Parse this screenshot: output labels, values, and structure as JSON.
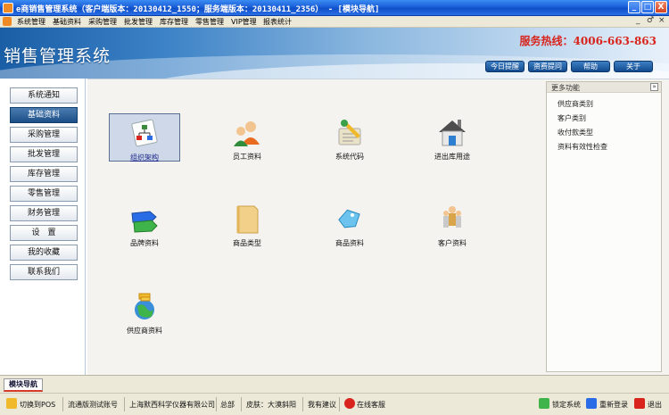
{
  "window": {
    "title": "e商销售管理系统（客户端版本：20130412_1550；服务端版本：20130411_2356） - [模块导航]",
    "controls": {
      "minimize": "_",
      "maximize": "□",
      "close": "X"
    }
  },
  "menubar": {
    "items": [
      "系统管理",
      "基础资料",
      "采购管理",
      "批发管理",
      "库存管理",
      "零售管理",
      "VIP管理",
      "报表统计"
    ],
    "mdi": {
      "minimize": "_",
      "restore": "♂",
      "close": "×"
    }
  },
  "header": {
    "system_title": "销售管理系统",
    "hotline": "服务热线：4006-663-863",
    "buttons": [
      "今日提醒",
      "资费提问",
      "帮助",
      "关于"
    ]
  },
  "nav": {
    "active_index": 1,
    "items": [
      "系统通知",
      "基础资料",
      "采购管理",
      "批发管理",
      "库存管理",
      "零售管理",
      "财务管理",
      "设　置",
      "我的收藏",
      "联系我们"
    ]
  },
  "modules": [
    {
      "label": "组织架构",
      "icon": "org-chart-icon",
      "selected": true
    },
    {
      "label": "员工资料",
      "icon": "staff-icon",
      "selected": false
    },
    {
      "label": "系统代码",
      "icon": "system-code-icon",
      "selected": false
    },
    {
      "label": "进出库用途",
      "icon": "warehouse-icon",
      "selected": false
    },
    {
      "label": "品牌资料",
      "icon": "brand-tag-icon",
      "selected": false
    },
    {
      "label": "商品类型",
      "icon": "folder-icon",
      "selected": false
    },
    {
      "label": "商品资料",
      "icon": "product-tag-icon",
      "selected": false
    },
    {
      "label": "客户资料",
      "icon": "customers-icon",
      "selected": false
    },
    {
      "label": "供应商资料",
      "icon": "supplier-globe-icon",
      "selected": false
    }
  ],
  "more_panel": {
    "title": "更多功能",
    "toggle": "»",
    "items": [
      "供应商类别",
      "客户类别",
      "收付款类型",
      "资料有效性检查"
    ]
  },
  "tabs": [
    "模块导航"
  ],
  "statusbar": {
    "switch_pos": "切换到POS",
    "account": "流通版测试账号",
    "company": "上海默西科学仪器有限公司",
    "dept": "总部",
    "skin": "皮肤：大漠斜阳",
    "suggest": "我有建议",
    "online": "在线客服",
    "lock": "锁定系统",
    "relogin": "重新登录",
    "exit": "退出"
  },
  "colors": {
    "accent": "#1c4f87",
    "hotline": "#d8241c",
    "titlebar": "#1b5fd8"
  }
}
